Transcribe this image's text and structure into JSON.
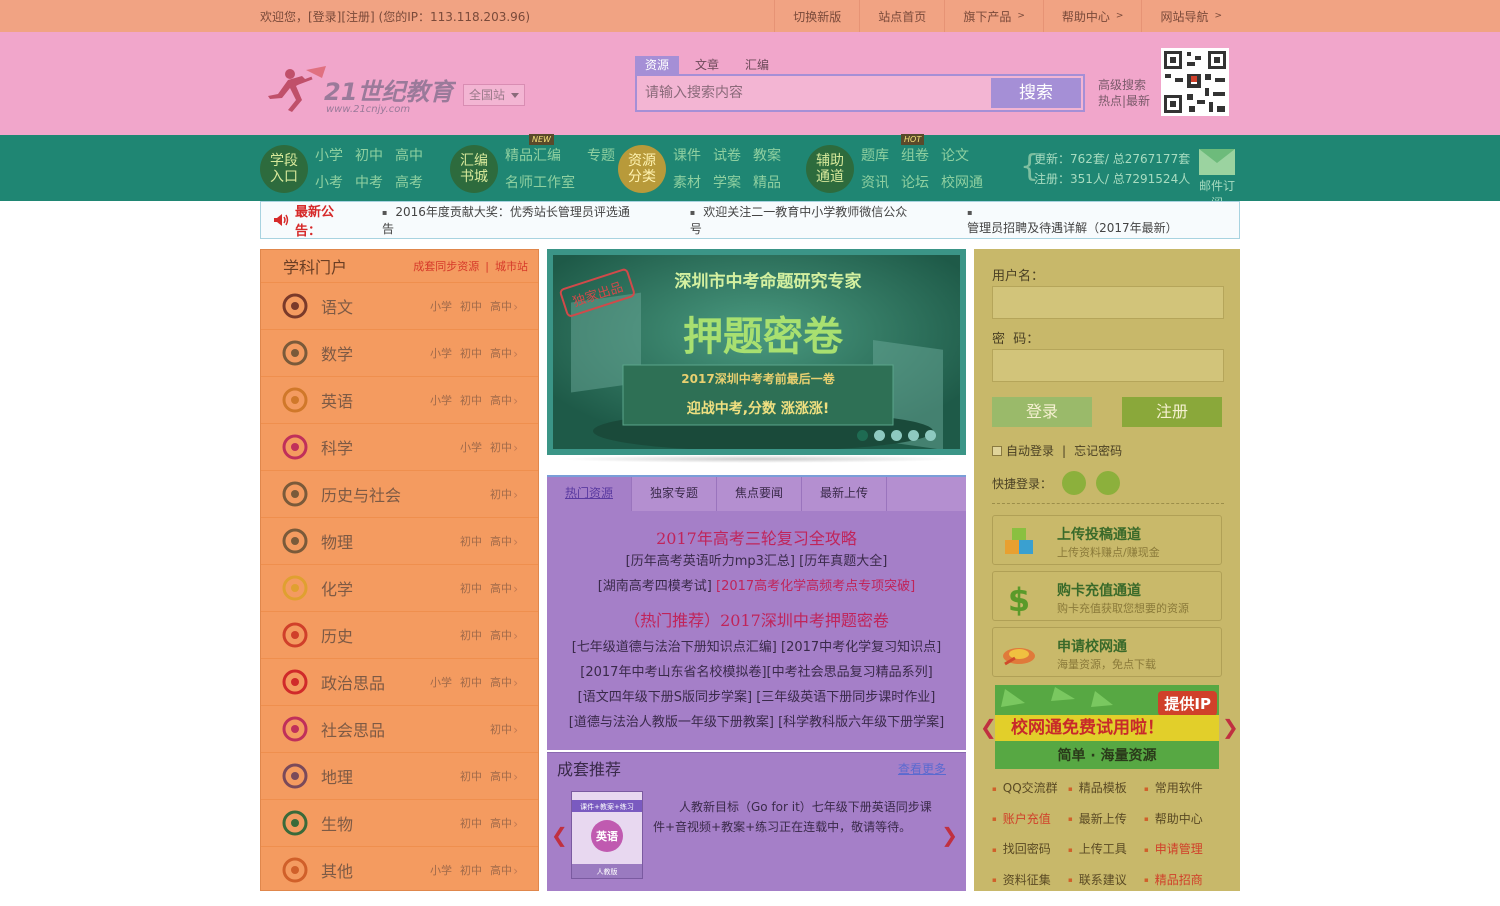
{
  "topbar": {
    "welcome": "欢迎您，[登录][注册] (您的IP：113.118.203.96)",
    "links": [
      "切换新版",
      "站点首页",
      "旗下产品",
      "帮助中心",
      "网站导航"
    ],
    "arrow": ">"
  },
  "header": {
    "logo_text": "21世纪教育",
    "logo_url": "www.21cnjy.com",
    "site_select": "全国站",
    "search_tabs": [
      "资源",
      "文章",
      "汇编"
    ],
    "search_placeholder": "请输入搜索内容",
    "search_button": "搜索",
    "adv_search": "高级搜索",
    "hot_latest": "热点|最新"
  },
  "nav": {
    "groups": [
      {
        "title": [
          "学段",
          "入口"
        ],
        "links": [
          "小学",
          "初中",
          "高中",
          "小考",
          "中考",
          "高考"
        ]
      },
      {
        "title": [
          "汇编",
          "书城"
        ],
        "links": [
          "精品汇编",
          "专题",
          "名师工作室"
        ],
        "badge": "NEW"
      },
      {
        "title": [
          "资源",
          "分类"
        ],
        "links": [
          "课件",
          "试卷",
          "教案",
          "素材",
          "学案",
          "精品"
        ]
      },
      {
        "title": [
          "辅助",
          "通道"
        ],
        "links": [
          "题库",
          "组卷",
          "论文",
          "资讯",
          "论坛",
          "校网通"
        ],
        "badge": "HOT"
      }
    ],
    "stats": [
      "更新：762套/ 总2767177套",
      "注册：351人/ 总7291524人"
    ],
    "mail": "邮件订阅"
  },
  "notice": {
    "title": "最新公告：",
    "items": [
      "2016年度贡献大奖：优秀站长管理员评选通告",
      "欢迎关注二一教育中小学教师微信公众号",
      "管理员招聘及待遇详解（2017年最新）"
    ]
  },
  "subjects": {
    "title": "学科门户",
    "links": [
      "成套同步资源",
      "城市站"
    ],
    "sep": "|",
    "items": [
      {
        "name": "语文",
        "levels": [
          "小学",
          "初中",
          "高中"
        ]
      },
      {
        "name": "数学",
        "levels": [
          "小学",
          "初中",
          "高中"
        ]
      },
      {
        "name": "英语",
        "levels": [
          "小学",
          "初中",
          "高中"
        ]
      },
      {
        "name": "科学",
        "levels": [
          "小学",
          "初中"
        ]
      },
      {
        "name": "历史与社会",
        "levels": [
          "初中"
        ]
      },
      {
        "name": "物理",
        "levels": [
          "初中",
          "高中"
        ]
      },
      {
        "name": "化学",
        "levels": [
          "初中",
          "高中"
        ]
      },
      {
        "name": "历史",
        "levels": [
          "初中",
          "高中"
        ]
      },
      {
        "name": "政治思品",
        "levels": [
          "小学",
          "初中",
          "高中"
        ]
      },
      {
        "name": "社会思品",
        "levels": [
          "初中"
        ]
      },
      {
        "name": "地理",
        "levels": [
          "初中",
          "高中"
        ]
      },
      {
        "name": "生物",
        "levels": [
          "初中",
          "高中"
        ]
      },
      {
        "name": "其他",
        "levels": [
          "小学",
          "初中",
          "高中"
        ]
      }
    ]
  },
  "banner": {
    "stamp": "独家出品",
    "headline": "深圳市中考命题研究专家",
    "big": "押题密卷",
    "line1": "2017深圳中考考前最后一卷",
    "line2": "迎战中考,分数 涨涨涨!",
    "slides": 5,
    "active": 1
  },
  "hot": {
    "tabs": [
      "热门资源",
      "独家专题",
      "焦点要闻",
      "最新上传"
    ],
    "h1": "2017年高考三轮复习全攻略",
    "lines1": [
      [
        "[历年高考英语听力mp3汇总]",
        "[历年真题大全]"
      ],
      [
        "[湖南高考四模考试]",
        "[2017高考化学高频考点专项突破]"
      ]
    ],
    "h2": "（热门推荐）2017深圳中考押题密卷",
    "lines2": [
      [
        "[七年级道德与法治下册知识点汇编]",
        "[2017中考化学复习知识点]"
      ],
      [
        "[2017年中考山东省名校模拟卷]",
        "[中考社会思品复习精品系列]"
      ],
      [
        "[语文四年级下册S版同步学案]",
        "[三年级英语下册同步课时作业]"
      ],
      [
        "[道德与法治人教版一年级下册教案]",
        "[科学教科版六年级下册学案]"
      ]
    ]
  },
  "sets": {
    "title": "成套推荐",
    "more": "查看更多",
    "desc": "人教新目标（Go for it）七年级下册英语同步课件+音视频+教案+练习正在连载中，敬请等待。",
    "book": {
      "top": "课件+教案+练习",
      "subject": "英语",
      "bottom": "人教版"
    }
  },
  "login": {
    "user_label": "用户名：",
    "pass_label": "密  码：",
    "login_button": "登录",
    "register_button": "注册",
    "auto_login": "自动登录",
    "sep": "|",
    "forgot": "忘记密码",
    "quick": "快捷登录："
  },
  "services": [
    {
      "title": "上传投稿通道",
      "sub": "上传资料赚点/赚现金"
    },
    {
      "title": "购卡充值通道",
      "sub": "购卡充值获取您想要的资源"
    },
    {
      "title": "申请校网通",
      "sub": "海量资源，免点下载"
    }
  ],
  "ad": {
    "tag": "提供IP",
    "main": "校网通免费试用啦！",
    "sub": "简单 · 海量资源"
  },
  "quicklinks": [
    {
      "t": "QQ交流群",
      "red": false
    },
    {
      "t": "精品模板",
      "red": false
    },
    {
      "t": "常用软件",
      "red": false
    },
    {
      "t": "账户充值",
      "red": true
    },
    {
      "t": "最新上传",
      "red": false
    },
    {
      "t": "帮助中心",
      "red": false
    },
    {
      "t": "找回密码",
      "red": false
    },
    {
      "t": "上传工具",
      "red": false
    },
    {
      "t": "申请管理",
      "red": true
    },
    {
      "t": "资料征集",
      "red": false
    },
    {
      "t": "联系建议",
      "red": false
    },
    {
      "t": "精品招商",
      "red": true
    }
  ]
}
